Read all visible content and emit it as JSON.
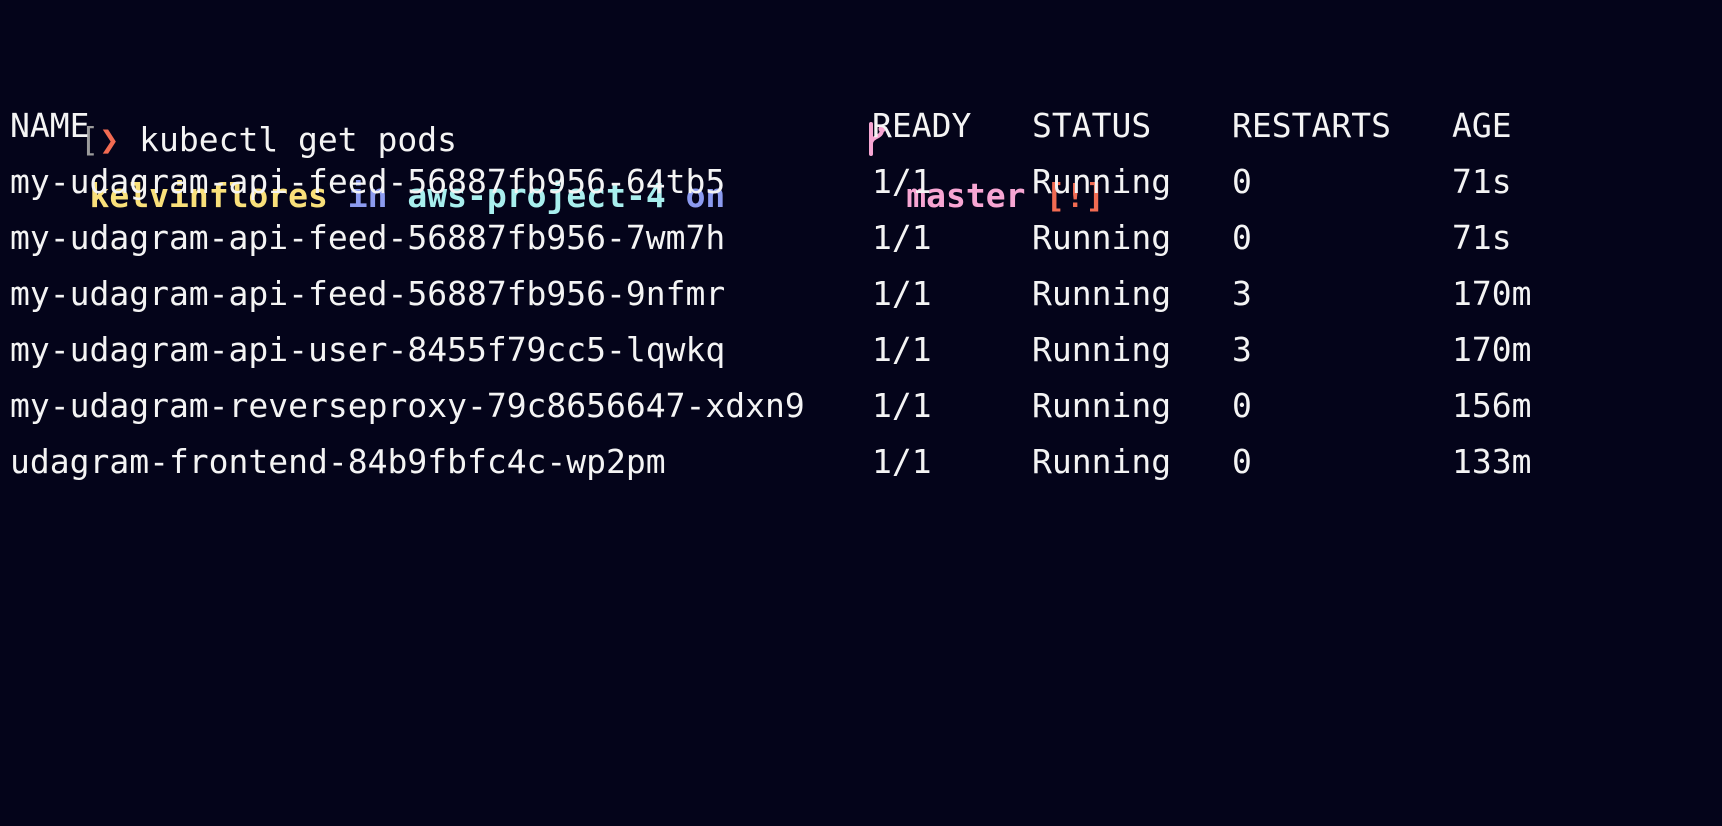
{
  "prompt": {
    "user": "kelvinflores",
    "in_word": "in",
    "directory": "aws-project-4",
    "on_word": "on",
    "branch_icon": "git-branch-icon",
    "branch": "master",
    "status_flag": "[!]"
  },
  "command": {
    "left_edge": "[",
    "arrow": "❯",
    "text": "kubectl get pods"
  },
  "table": {
    "headers": [
      "NAME",
      "READY",
      "STATUS",
      "RESTARTS",
      "AGE"
    ],
    "rows": [
      [
        "my-udagram-api-feed-56887fb956-64tb5",
        "1/1",
        "Running",
        "0",
        "71s"
      ],
      [
        "my-udagram-api-feed-56887fb956-7wm7h",
        "1/1",
        "Running",
        "0",
        "71s"
      ],
      [
        "my-udagram-api-feed-56887fb956-9nfmr",
        "1/1",
        "Running",
        "3",
        "170m"
      ],
      [
        "my-udagram-api-user-8455f79cc5-lqwkq",
        "1/1",
        "Running",
        "3",
        "170m"
      ],
      [
        "my-udagram-reverseproxy-79c8656647-xdxn9",
        "1/1",
        "Running",
        "0",
        "156m"
      ],
      [
        "udagram-frontend-84b9fbfc4c-wp2pm",
        "1/1",
        "Running",
        "0",
        "133m"
      ]
    ]
  },
  "colors": {
    "background": "#04041a",
    "user": "#f9e07a",
    "keyword": "#8c9bf0",
    "directory": "#a8efee",
    "branch": "#f7a6d3",
    "flag": "#f26b52",
    "text": "#f4f4f4"
  }
}
